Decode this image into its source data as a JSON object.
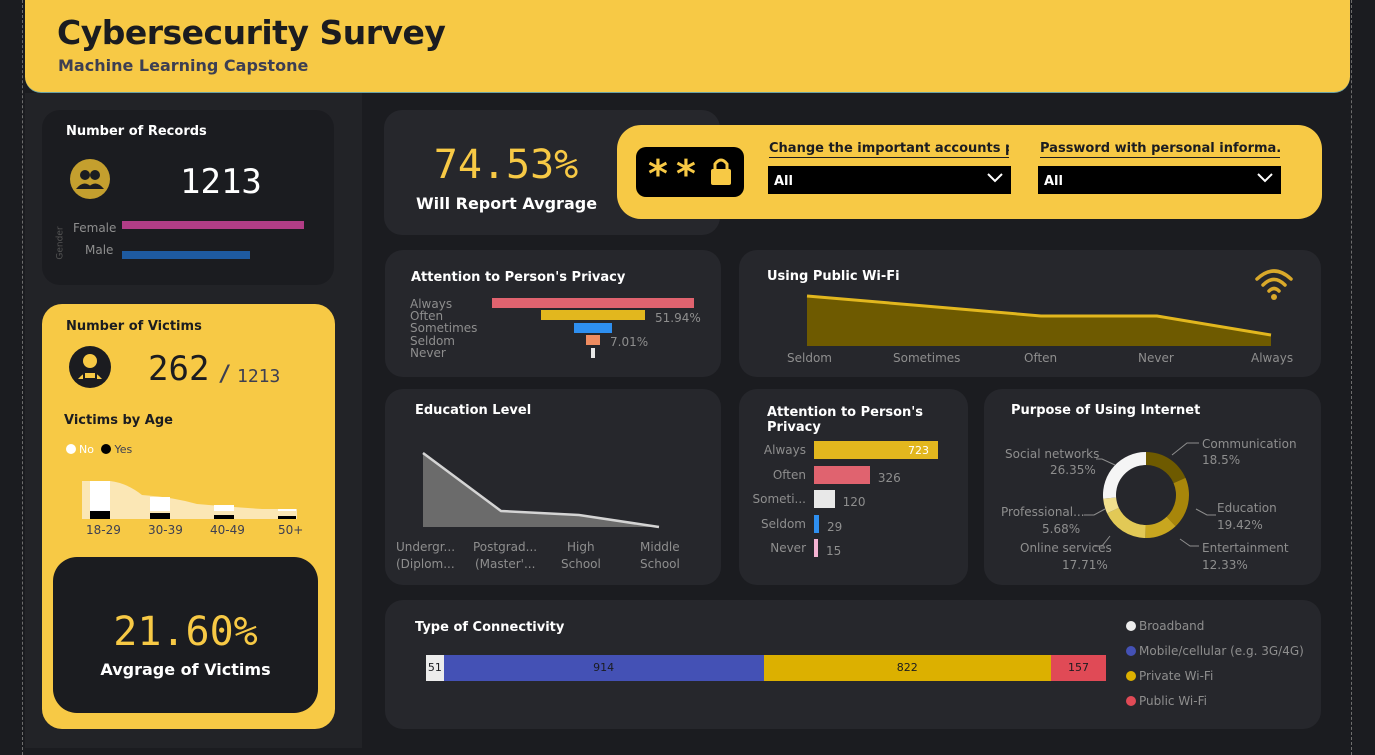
{
  "header": {
    "title": "Cybersecurity Survey",
    "subtitle": "Machine Learning Capstone"
  },
  "records": {
    "title": "Number of Records",
    "value": "1213",
    "axis_label": "Gender",
    "bars": [
      {
        "label": "Female",
        "fraction": 0.98,
        "color": "#b23d86"
      },
      {
        "label": "Male",
        "fraction": 0.69,
        "color": "#1e5aa0"
      }
    ]
  },
  "victims": {
    "title": "Number of Victims",
    "value": "262",
    "separator": "/",
    "total": "1213",
    "by_age_title": "Victims by Age",
    "legend_no": "No",
    "legend_yes": "Yes",
    "age_labels": [
      "18-29",
      "30-39",
      "40-49",
      "50+"
    ]
  },
  "avg_victims": {
    "value": "21.60%",
    "label": "Avgrage of Victims"
  },
  "will_report": {
    "value": "74.53%",
    "label": "Will Report Avgrage"
  },
  "filters": {
    "icon": "password-lock-icon",
    "f1": {
      "label": "Change the important accounts p...",
      "value": "All"
    },
    "f2": {
      "label": "Password with personal informa...",
      "value": "All"
    }
  },
  "privacy_funnel": {
    "title": "Attention to Person's Privacy",
    "labels": [
      "Always",
      "Often",
      "Sometimes",
      "Seldom",
      "Never"
    ],
    "pct_often": "51.94%",
    "pct_seldom": "7.01%"
  },
  "wifi": {
    "title": "Using Public Wi-Fi",
    "icon": "wifi-icon",
    "categories": [
      "Seldom",
      "Sometimes",
      "Often",
      "Never",
      "Always"
    ]
  },
  "education": {
    "title": "Education Level",
    "labels": [
      [
        "Undergr...",
        "(Diplom..."
      ],
      [
        "Postgrad...",
        "(Master'..."
      ],
      [
        "High",
        "School"
      ],
      [
        "Middle",
        "School"
      ]
    ]
  },
  "privacy_bars": {
    "title": "Attention to Person's Privacy",
    "categories": [
      "Always",
      "Often",
      "Someti...",
      "Seldom",
      "Never"
    ],
    "values": [
      723,
      326,
      120,
      29,
      15
    ],
    "colors": [
      "#e2b71e",
      "#e0636f",
      "#e8e8e8",
      "#2e8ff0",
      "#f4b3d2"
    ]
  },
  "purpose": {
    "title": "Purpose of Using Internet",
    "labels": {
      "social": [
        "Social networks",
        "26.35%"
      ],
      "comm": [
        "Communication",
        "18.5%"
      ],
      "edu": [
        "Education",
        "19.42%"
      ],
      "ent": [
        "Entertainment",
        "12.33%"
      ],
      "online": [
        "Online services",
        "17.71%"
      ],
      "prof": [
        "Professional...",
        "5.68%"
      ]
    }
  },
  "connectivity": {
    "title": "Type of Connectivity",
    "legend": [
      "Broadband",
      "Mobile/cellular (e.g. 3G/4G)",
      "Private Wi-Fi",
      "Public Wi-Fi"
    ],
    "colors": [
      "#ececec",
      "#4451b5",
      "#dcb000",
      "#e04a56"
    ]
  },
  "chart_data": [
    {
      "type": "bar",
      "title": "Number of Records",
      "ylabel": "Gender",
      "categories": [
        "Female",
        "Male"
      ],
      "values": [
        0.98,
        0.69
      ]
    },
    {
      "type": "area",
      "title": "Victims by Age",
      "categories": [
        "18-29",
        "30-39",
        "40-49",
        "50+"
      ],
      "series": [
        {
          "name": "No",
          "values": [
            20,
            13,
            9,
            4
          ]
        },
        {
          "name": "Yes",
          "values": [
            5,
            3,
            2,
            1
          ]
        }
      ]
    },
    {
      "type": "bar",
      "title": "Attention to Person's Privacy",
      "categories": [
        "Always",
        "Often",
        "Sometimes",
        "Seldom",
        "Never"
      ],
      "values": [
        100,
        51.94,
        19,
        7.01,
        2
      ],
      "colors": [
        "#e0636f",
        "#e2b71e",
        "#2e8ff0",
        "#ef8c60",
        "#e8e8e8"
      ]
    },
    {
      "type": "area",
      "title": "Using Public Wi-Fi",
      "categories": [
        "Seldom",
        "Sometimes",
        "Often",
        "Never",
        "Always"
      ],
      "values": [
        100,
        90,
        80,
        65,
        22
      ]
    },
    {
      "type": "area",
      "title": "Education Level",
      "categories": [
        "Undergraduate (Diploma)",
        "Postgraduate (Master's)",
        "High School",
        "Middle School"
      ],
      "values": [
        100,
        22,
        17,
        2
      ]
    },
    {
      "type": "bar",
      "title": "Attention to Person's Privacy",
      "categories": [
        "Always",
        "Often",
        "Sometimes",
        "Seldom",
        "Never"
      ],
      "values": [
        723,
        326,
        120,
        29,
        15
      ]
    },
    {
      "type": "pie",
      "title": "Purpose of Using Internet",
      "categories": [
        "Communication",
        "Education",
        "Entertainment",
        "Online services",
        "Professional...",
        "Social networks"
      ],
      "values": [
        18.5,
        19.42,
        12.33,
        17.71,
        5.68,
        26.35
      ],
      "colors": [
        "#6e5a00",
        "#a8860a",
        "#c8a61f",
        "#e2c956",
        "#f1e08e",
        "#f5f5f5"
      ]
    },
    {
      "type": "bar",
      "title": "Type of Connectivity",
      "categories": [
        "Broadband",
        "Mobile/cellular (e.g. 3G/4G)",
        "Private Wi-Fi",
        "Public Wi-Fi"
      ],
      "values": [
        51,
        914,
        822,
        157
      ],
      "colors": [
        "#ececec",
        "#4451b5",
        "#dcb000",
        "#e04a56"
      ]
    }
  ]
}
